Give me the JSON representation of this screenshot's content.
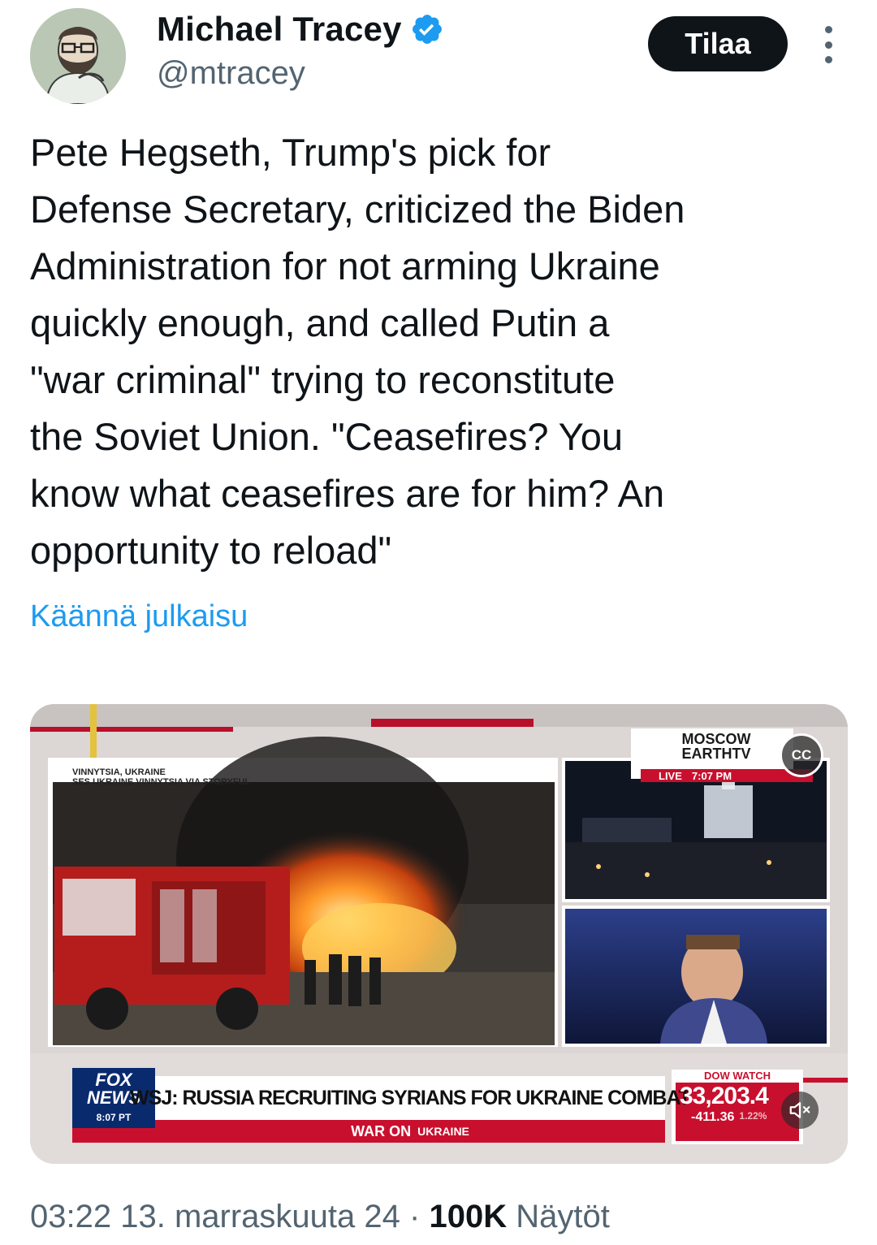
{
  "author": {
    "name": "Michael Tracey",
    "handle": "@mtracey",
    "verified": true,
    "avatar_icon": "bearded-man-with-glasses-avatar"
  },
  "actions": {
    "subscribe_label": "Tilaa",
    "more_icon": "vertical-ellipsis-icon"
  },
  "tweet": {
    "text": "Pete Hegseth, Trump's pick for\nDefense Secretary, criticized the Biden\nAdministration for not arming Ukraine\nquickly enough, and called Putin a\n\"war criminal\" trying to reconstitute\nthe Soviet Union. \"Ceasefires? You\nknow what ceasefires are for him? An\nopportunity to reload\"",
    "translate_label": "Käännä julkaisu"
  },
  "video": {
    "left_caption_line1": "VINNYTSIA, UKRAINE",
    "left_caption_line2": "SES UKRAINE VINNYTSIA VIA STORYFUL",
    "right_caption_line1": "MOSCOW",
    "right_caption_line2": "EARTHTV",
    "live_label": "LIVE",
    "live_time": "7:07 PM",
    "cc_label": "CC",
    "channel_line1": "FOX",
    "channel_line2": "NEWS",
    "channel_time": "8:07 PT",
    "headline": "WSJ: RUSSIA RECRUITING SYRIANS FOR UKRAINE COMBAT",
    "subheadline_part1": "WAR ON",
    "subheadline_part2": "UKRAINE",
    "ticker_title": "DOW WATCH",
    "ticker_value": "33,203.4",
    "ticker_change": "-411.36",
    "ticker_pct": "1.22%",
    "mute_icon": "speaker-muted-icon",
    "colors": {
      "fox_blue": "#0a2a6e",
      "fox_red": "#c8102e"
    }
  },
  "meta": {
    "time": "03:22",
    "date": "13. marraskuuta 24",
    "separator": "·",
    "views_count": "100K",
    "views_label": "Näytöt"
  },
  "colors": {
    "accent": "#1d9bf0",
    "text": "#0f1419",
    "secondary": "#536471"
  }
}
